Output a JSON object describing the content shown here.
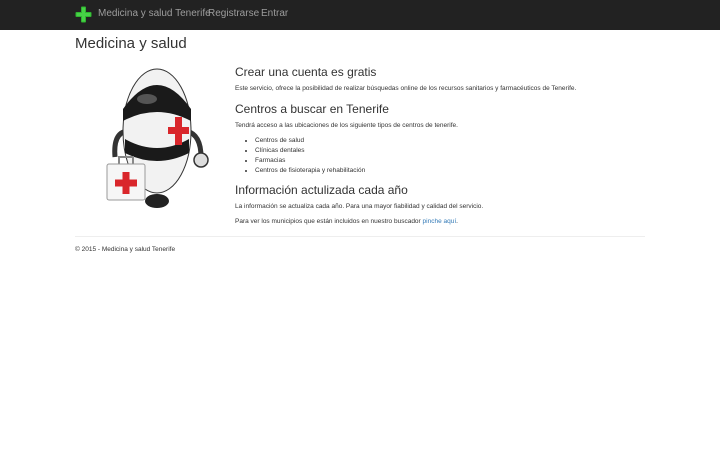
{
  "navbar": {
    "brand_icon": "green-medical-cross-icon",
    "brand": "Medicina y salud Tenerife",
    "links": [
      "Registrarse",
      "Entrar"
    ],
    "background": "#222222",
    "link_color": "#9d9d9d"
  },
  "page": {
    "title": "Medicina y salud"
  },
  "hero": {
    "image": "robot-with-red-cross-first-aid-kit"
  },
  "sections": [
    {
      "heading": "Crear una cuenta es gratis",
      "text": "Este servicio, ofrece la posibilidad de realizar búsquedas online de los recursos sanitarios y farmacéuticos de Tenerife."
    },
    {
      "heading": "Centros a buscar en Tenerife",
      "text": "Tendrá acceso a las ubicaciones de los siguiente tipos de centros de tenerife.",
      "items": [
        "Centros de salud",
        "Clínicas dentales",
        "Farmacias",
        "Centros de fisioterapia y rehabilitación"
      ]
    },
    {
      "heading": "Información actulizada cada año",
      "text": "La información se actualiza cada año. Para una mayor fiabilidad y calidad del servicio.",
      "text2": "Para ver los municipios que están incluidos en nuestro buscador",
      "link": "pinche aquí",
      "text2_end": "."
    }
  ],
  "footer": {
    "text": "© 2015 - Medicina y salud Tenerife"
  },
  "colors": {
    "accent_red": "#d9262b",
    "brand_green": "#2fb52f",
    "link": "#337ab7"
  }
}
